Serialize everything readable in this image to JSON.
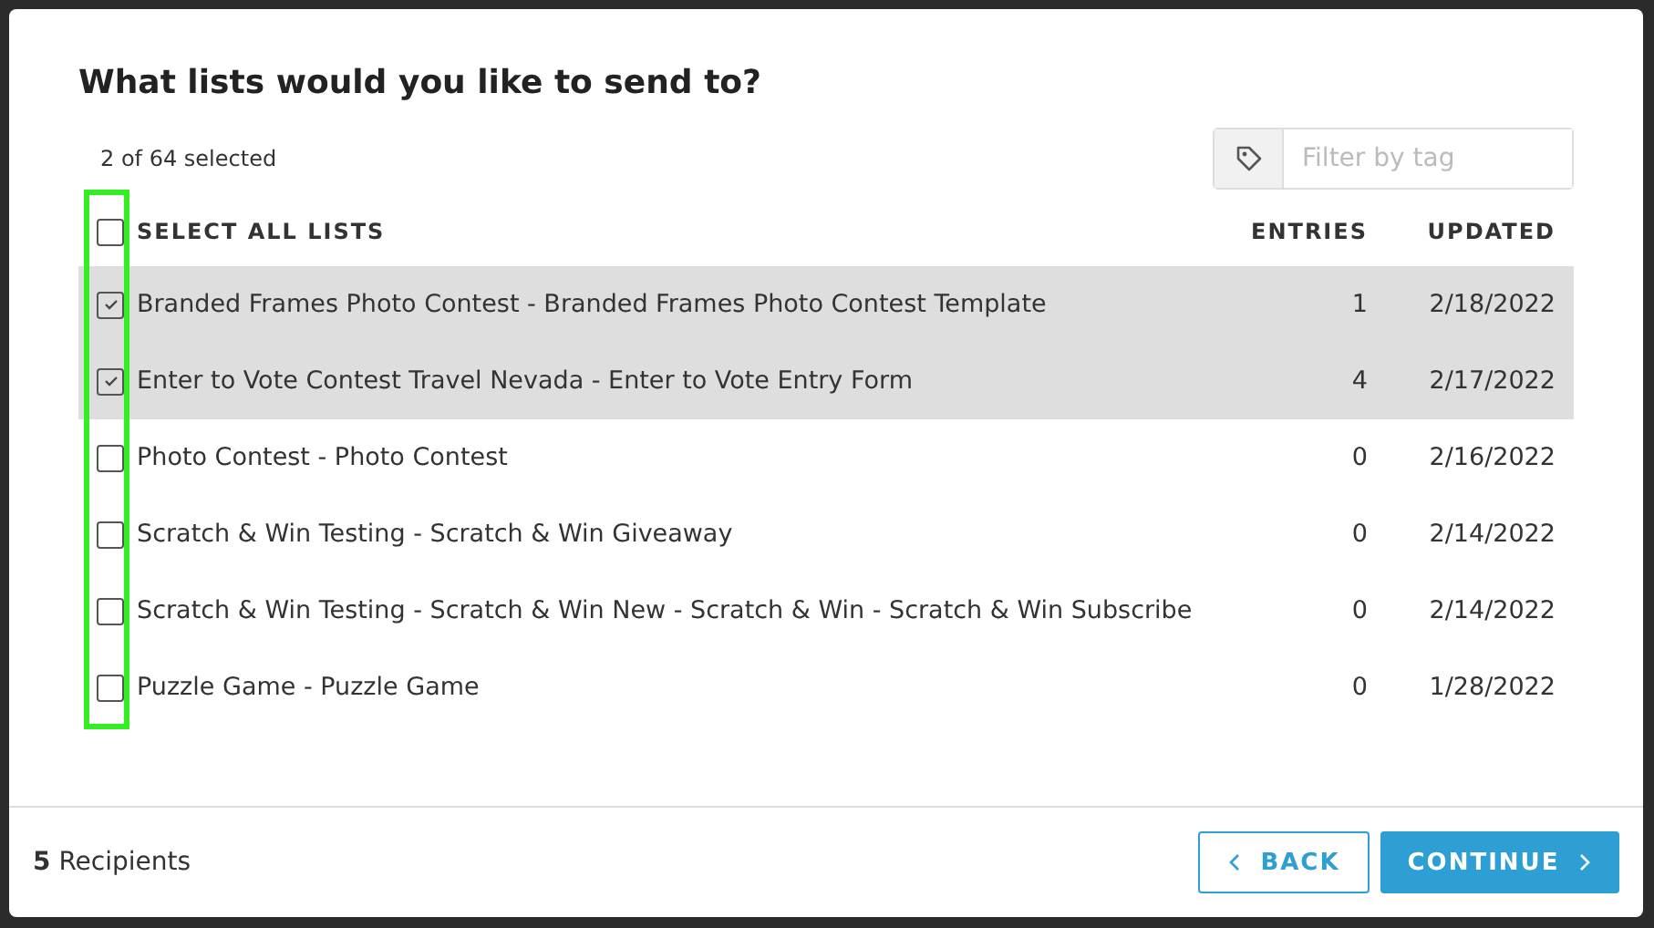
{
  "dialog": {
    "title": "What lists would you like to send to?"
  },
  "selection_count": "2 of 64 selected",
  "tag_filter": {
    "placeholder": "Filter by tag"
  },
  "table": {
    "select_all": {
      "label": "SELECT ALL LISTS",
      "checked": false
    },
    "columns": [
      "ENTRIES",
      "UPDATED"
    ],
    "rows": [
      {
        "name": "Branded Frames Photo Contest - Branded Frames Photo Contest Template",
        "entries": "1",
        "updated": "2/18/2022",
        "checked": true
      },
      {
        "name": "Enter to Vote Contest Travel Nevada - Enter to Vote Entry Form",
        "entries": "4",
        "updated": "2/17/2022",
        "checked": true
      },
      {
        "name": "Photo Contest - Photo Contest",
        "entries": "0",
        "updated": "2/16/2022",
        "checked": false
      },
      {
        "name": "Scratch & Win Testing - Scratch & Win Giveaway",
        "entries": "0",
        "updated": "2/14/2022",
        "checked": false
      },
      {
        "name": "Scratch & Win Testing - Scratch & Win New - Scratch & Win - Scratch & Win Subscribe",
        "entries": "0",
        "updated": "2/14/2022",
        "checked": false
      },
      {
        "name": "Puzzle Game - Puzzle Game",
        "entries": "0",
        "updated": "1/28/2022",
        "checked": false
      }
    ]
  },
  "footer": {
    "count": "5",
    "label": "Recipients",
    "back": "BACK",
    "continue": "CONTINUE"
  }
}
